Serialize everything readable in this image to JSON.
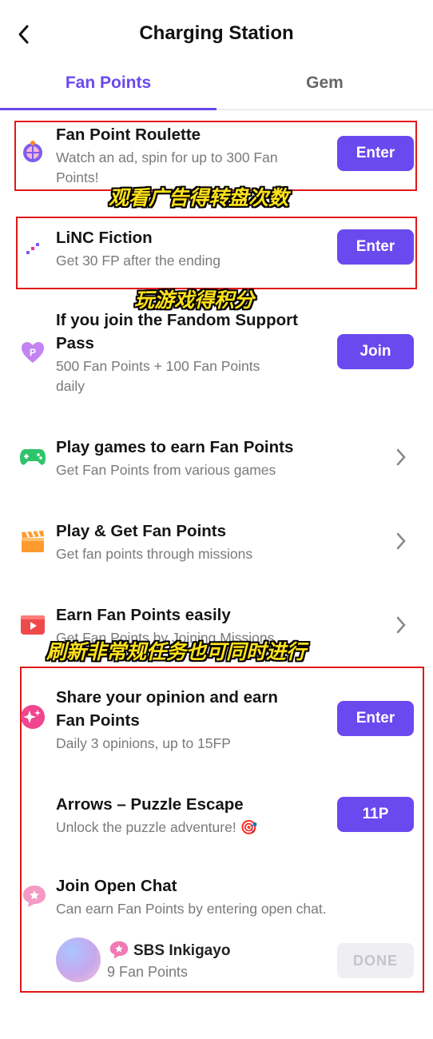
{
  "header": {
    "title": "Charging Station"
  },
  "tabs": [
    {
      "label": "Fan Points",
      "active": true
    },
    {
      "label": "Gem",
      "active": false
    }
  ],
  "rows": [
    {
      "title": "Fan Point Roulette",
      "subtitle_line1": "Watch an ad, spin for up to 300 Fan",
      "subtitle_line2": "Points!",
      "button": "Enter",
      "icon": "roulette-icon"
    },
    {
      "title": "LiNC Fiction",
      "subtitle": "Get 30 FP after the ending",
      "button": "Enter",
      "icon": "linc-icon"
    },
    {
      "title_line1": "If you join the Fandom Support",
      "title_line2": "Pass",
      "subtitle_line1": "500 Fan Points + 100 Fan Points",
      "subtitle_line2": "daily",
      "button": "Join",
      "icon": "heart-p-icon"
    },
    {
      "title": "Play games to earn Fan Points",
      "subtitle": "Get Fan Points from various games",
      "icon": "gamepad-icon"
    },
    {
      "title": "Play & Get Fan Points",
      "subtitle": "Get fan points through missions",
      "icon": "clapperboard-icon"
    },
    {
      "title": "Earn Fan Points easily",
      "subtitle": "Get Fan Points by Joining Missions",
      "icon": "video-play-icon"
    },
    {
      "title_line1": "Share your opinion and earn",
      "title_line2": "Fan Points",
      "subtitle": "Daily 3 opinions, up to 15FP",
      "button": "Enter",
      "icon": "sparkle-icon"
    },
    {
      "title": "Arrows – Puzzle Escape",
      "subtitle": "Unlock the puzzle adventure! 🎯",
      "button": "11P"
    },
    {
      "title": "Join Open Chat",
      "subtitle": "Can earn Fan Points by entering open chat.",
      "icon": "chat-star-icon"
    }
  ],
  "open_chat_item": {
    "name": "SBS Inkigayo",
    "points": "9 Fan Points",
    "button": "DONE"
  },
  "captions": {
    "c1": "观看广告得转盘次数",
    "c2": "玩游戏得积分",
    "c3": "刷新非常规任务也可同时进行"
  },
  "colors": {
    "accent": "#6a49ef",
    "annotation_red": "#e11818",
    "caption_yellow": "#ffe11a"
  }
}
